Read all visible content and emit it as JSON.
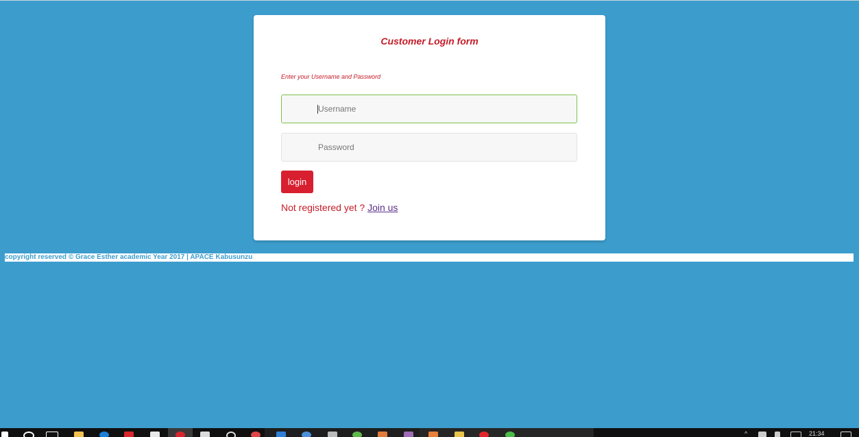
{
  "form": {
    "title": "Customer Login form",
    "subtitle": "Enter your Username and Password",
    "username_placeholder": "Username",
    "username_value": "",
    "password_placeholder": "Password",
    "password_value": "",
    "login_label": "login",
    "register_text": "Not registered yet ?",
    "join_label": "Join us"
  },
  "footer": {
    "text": "copyright reserved © Grace Esther academic Year 2017 | APACE Kabusunzu"
  },
  "taskbar": {
    "clock": "21:34",
    "icons": [
      "start-icon",
      "search-icon",
      "task-view-icon",
      "file-explorer-icon",
      "edge-icon",
      "app-icon",
      "store-icon",
      "chrome-icon",
      "notepad-icon",
      "app-icon",
      "clock-icon",
      "window-icon",
      "app-icon",
      "app-icon",
      "app-icon",
      "app-icon",
      "app-icon",
      "app-icon",
      "app-icon",
      "app-icon",
      "app-icon"
    ]
  },
  "colors": {
    "background": "#3c9dcd",
    "accent_red": "#c51b27",
    "button_red": "#d71f30",
    "link_purple": "#5a2d8a",
    "focus_green": "#7cc04d"
  }
}
